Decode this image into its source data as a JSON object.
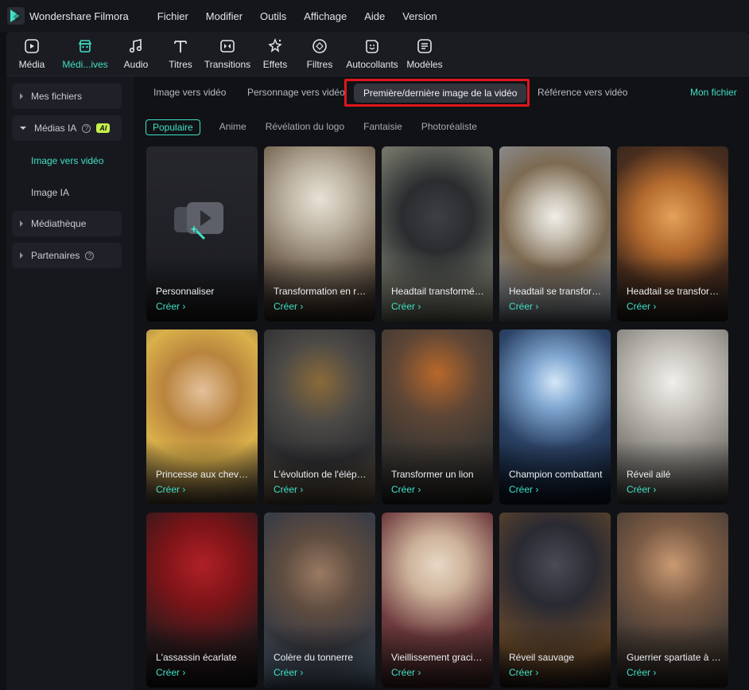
{
  "app": {
    "name": "Wondershare Filmora"
  },
  "menu": [
    "Fichier",
    "Modifier",
    "Outils",
    "Affichage",
    "Aide",
    "Version"
  ],
  "toolbar": [
    {
      "label": "Média",
      "icon": "media-icon"
    },
    {
      "label": "Médi...ives",
      "icon": "store-icon",
      "active": true
    },
    {
      "label": "Audio",
      "icon": "music-note-icon"
    },
    {
      "label": "Titres",
      "icon": "text-icon"
    },
    {
      "label": "Transitions",
      "icon": "transition-icon"
    },
    {
      "label": "Effets",
      "icon": "effects-icon"
    },
    {
      "label": "Filtres",
      "icon": "filters-icon"
    },
    {
      "label": "Autocollants",
      "icon": "sticker-icon"
    },
    {
      "label": "Modèles",
      "icon": "templates-icon"
    }
  ],
  "sidebar": {
    "mes_fichiers": "Mes fichiers",
    "medias_ia": "Médias IA",
    "ai_badge": "AI",
    "help": "?",
    "image_vers_video": "Image vers vidéo",
    "image_ia": "Image IA",
    "mediatheque": "Médiathèque",
    "partenaires": "Partenaires"
  },
  "tabs": {
    "image_vers_video": "Image vers vidéo",
    "personnage": "Personnage vers vidéo",
    "premiere_derniere": "Première/dernière image de la vidéo",
    "reference": "Référence vers vidéo",
    "mon_fichier": "Mon fichier"
  },
  "filters": [
    "Populaire",
    "Anime",
    "Révélation du logo",
    "Fantaisie",
    "Photoréaliste"
  ],
  "cta": "Créer",
  "cards": [
    {
      "title": "Personnaliser"
    },
    {
      "title": "Transformation en renard"
    },
    {
      "title": "Headtail transformé en aigle"
    },
    {
      "title": "Headtail se transforme en aigle"
    },
    {
      "title": "Headtail se transforme en tigre"
    },
    {
      "title": "Princesse aux cheveux bruns"
    },
    {
      "title": "L'évolution de l'éléphant"
    },
    {
      "title": "Transformer un lion"
    },
    {
      "title": "Champion combattant"
    },
    {
      "title": "Réveil ailé"
    },
    {
      "title": "L'assassin écarlate"
    },
    {
      "title": "Colère du tonnerre"
    },
    {
      "title": "Vieillissement gracieux"
    },
    {
      "title": "Réveil sauvage"
    },
    {
      "title": "Guerrier spartiate à l'arène"
    }
  ],
  "colors": {
    "accent": "#3fe0c5",
    "highlight": "#e0161c",
    "badge": "#c5f04a"
  }
}
